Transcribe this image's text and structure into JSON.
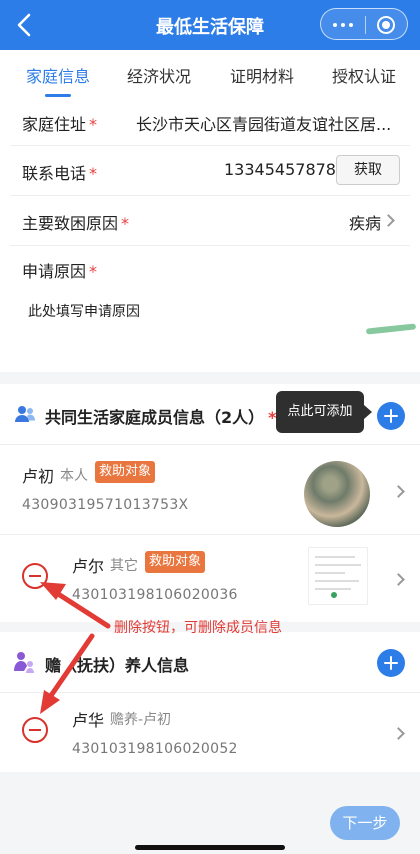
{
  "header": {
    "title": "最低生活保障"
  },
  "tabs": [
    {
      "label": "家庭信息",
      "active": true
    },
    {
      "label": "经济状况",
      "active": false
    },
    {
      "label": "证明材料",
      "active": false
    },
    {
      "label": "授权认证",
      "active": false
    }
  ],
  "form": {
    "address_label": "家庭住址",
    "address_value": "长沙市天心区青园街道友谊社区居...",
    "phone_label": "联系电话",
    "phone_value": "13345457878",
    "get_button": "获取",
    "cause_label": "主要致困原因",
    "cause_value": "疾病",
    "reason_label": "申请原因",
    "reason_placeholder": "此处填写申请原因",
    "required_mark": "*"
  },
  "family_section": {
    "title": "共同生活家庭成员信息（2人）",
    "required_mark": "*",
    "tooltip": "点此可添加",
    "members": [
      {
        "name": "卢初",
        "relation": "本人",
        "badge": "救助对象",
        "id": "43090319571013753X"
      },
      {
        "name": "卢尔",
        "relation": "其它",
        "badge": "救助对象",
        "id": "430103198106020036"
      }
    ]
  },
  "annotation": "删除按钮，可删除成员信息",
  "support_section": {
    "title": "赡（抚扶）养人信息",
    "members": [
      {
        "name": "卢华",
        "relation": "赡养-卢初",
        "id": "430103198106020052"
      }
    ]
  },
  "footer": {
    "next_button": "下一步"
  },
  "colors": {
    "primary": "#2d7de8",
    "badge": "#e9763e",
    "danger": "#e23b35"
  }
}
